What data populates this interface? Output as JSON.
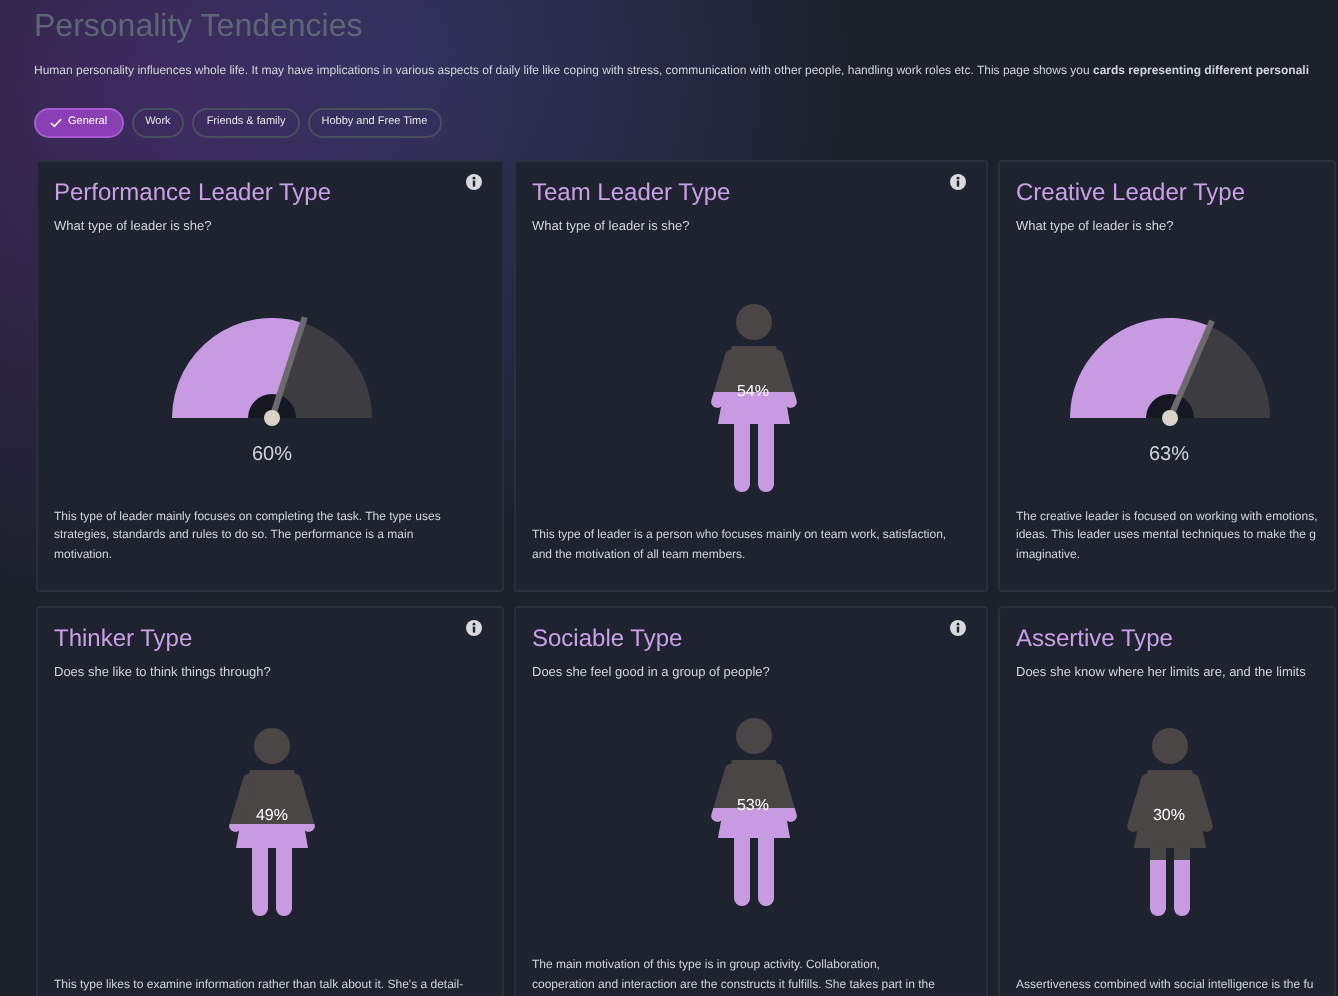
{
  "page": {
    "title": "Personality Tendencies",
    "description": "Human personality influences whole life. It may have implications in various aspects of daily life like coping with stress, communication with other people, handling work roles etc. This page shows you **cards representing different personali**"
  },
  "filters": [
    {
      "label": "General",
      "selected": true
    },
    {
      "label": "Work",
      "selected": false
    },
    {
      "label": "Friends & family",
      "selected": false
    },
    {
      "label": "Hobby and Free Time",
      "selected": false
    }
  ],
  "cards": [
    {
      "title": "Performance Leader Type",
      "question": "What type of leader is she?",
      "kind": "gauge",
      "level": 0.6,
      "value": "60%",
      "info": true,
      "description": [
        "This type of leader mainly focuses on completing the task. The type uses",
        "strategies, standards and rules to do so. The performance is a main",
        "motivation."
      ]
    },
    {
      "title": "Team Leader Type",
      "question": "What type of leader is she?",
      "kind": "figure",
      "level": 0.54,
      "value": "54%",
      "info": true,
      "description": [
        "This type of leader is a person who focuses mainly on team work, satisfaction,",
        "and the motivation of all team members."
      ]
    },
    {
      "title": "Creative Leader Type",
      "question": "What type of leader is she?",
      "kind": "gauge",
      "level": 0.63,
      "value": "63%",
      "info": false,
      "description": [
        "The creative leader is focused on working with emotions,",
        "ideas. This leader uses mental techniques to make the g",
        "imaginative."
      ]
    },
    {
      "title": "Thinker Type",
      "question": "Does she like to think things through?",
      "kind": "figure",
      "level": 0.49,
      "value": "49%",
      "info": true,
      "description": [
        "This type likes to examine information rather than talk about it. She's a detail-"
      ]
    },
    {
      "title": "Sociable Type",
      "question": "Does she feel good in a group of people?",
      "kind": "figure",
      "level": 0.53,
      "value": "53%",
      "info": true,
      "description": [
        "The main motivation of this type is in group activity. Collaboration,",
        "cooperation and interaction are the constructs it fulfills. She takes part in the"
      ]
    },
    {
      "title": "Assertive Type",
      "question": "Does she know where her limits are, and the limits",
      "kind": "figure",
      "level": 0.3,
      "value": "30%",
      "info": false,
      "description": [
        "Assertiveness combined with social intelligence is the fu"
      ]
    }
  ]
}
